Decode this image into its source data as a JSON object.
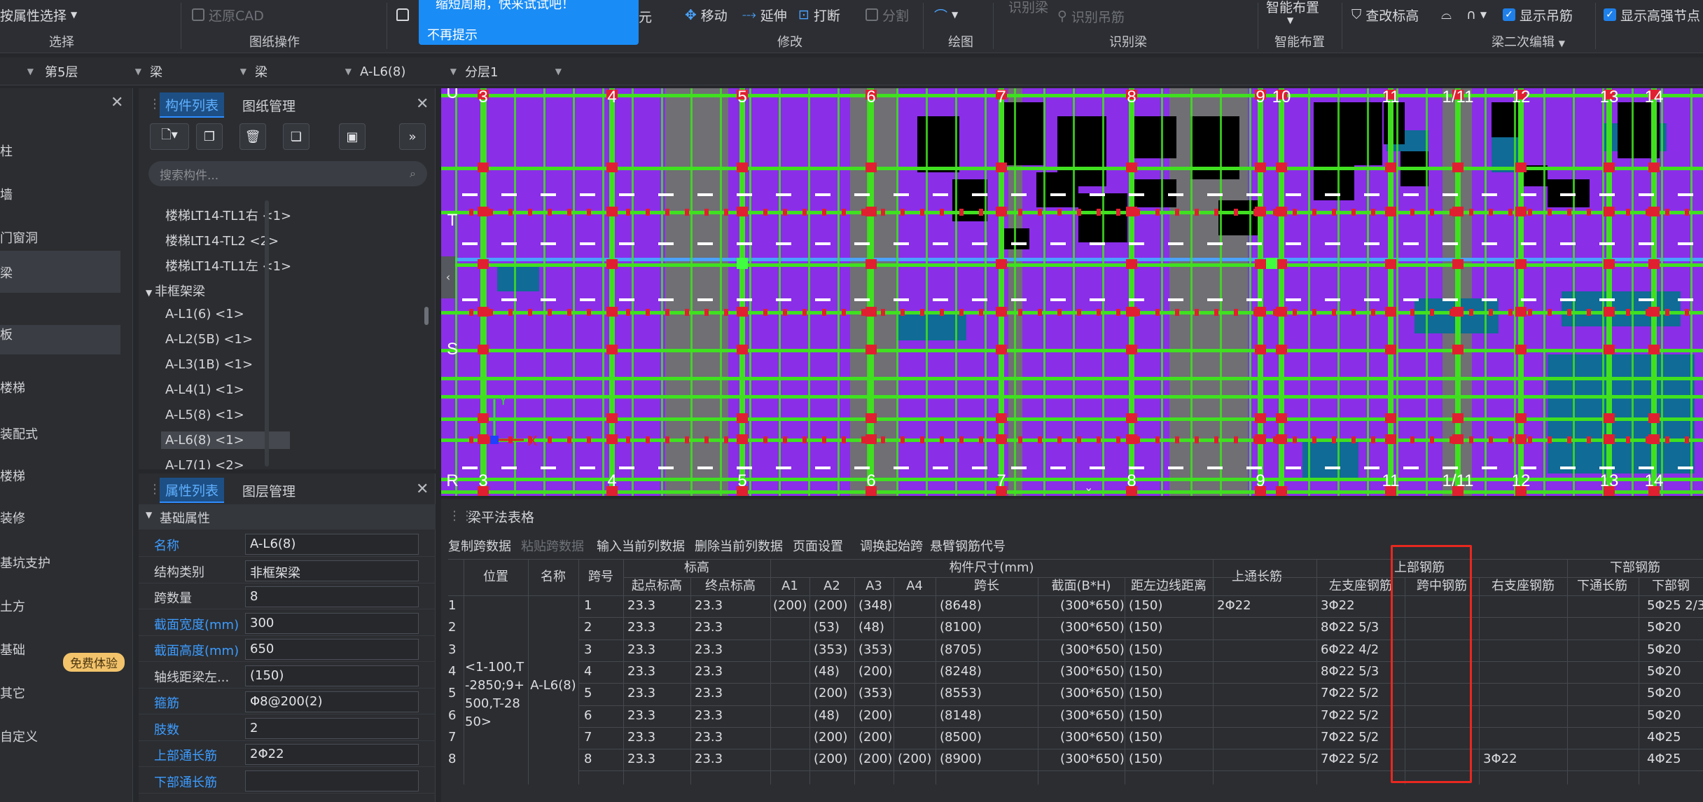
{
  "ribbon": {
    "select_by_attr": "按属性选择",
    "restore_cad": "还原CAD",
    "group_select": "选择",
    "group_drawing_ops": "图纸操作",
    "yuan": "元",
    "move": "移动",
    "extend": "延伸",
    "break": "打断",
    "split": "分割",
    "group_modify": "修改",
    "group_draw": "绘图",
    "identify_beam_label": "识别梁",
    "identify_hanger": "识别吊筋",
    "group_identify_beam": "识别梁",
    "smart_layout": "智能布置",
    "group_smart_layout": "智能布置",
    "check_elevation": "查改标高",
    "show_hanger": "显示吊筋",
    "show_strong_node": "显示高强节点",
    "group_beam_edit": "梁二次编辑"
  },
  "popup": {
    "message": "缩短周期，快来试试吧！",
    "dismiss": "不再提示"
  },
  "filter": {
    "floor": "第5层",
    "type1": "梁",
    "type2": "梁",
    "component": "A-L6(8)",
    "layer": "分层1"
  },
  "leftnav": {
    "items": [
      "柱",
      "墙",
      "门窗洞",
      "梁",
      "板",
      "楼梯",
      "装配式",
      "楼梯",
      "装修",
      "基坑支护",
      "土方",
      "基础",
      "其它",
      "自定义"
    ],
    "badge": "免费体验"
  },
  "comp_panel": {
    "tab_list": "构件列表",
    "tab_drawing": "图纸管理",
    "search_placeholder": "搜索构件...",
    "items": [
      "楼梯LT14-TL1右 <1>",
      "楼梯LT14-TL2 <2>",
      "楼梯LT14-TL1左 <1>"
    ],
    "group": "非框架梁",
    "beams": [
      "A-L1(6) <1>",
      "A-L2(5B) <1>",
      "A-L3(1B) <1>",
      "A-L4(1) <1>",
      "A-L5(8) <1>",
      "A-L6(8) <1>",
      "A-L7(1) <2>"
    ]
  },
  "prop_panel": {
    "tab_props": "属性列表",
    "tab_layers": "图层管理",
    "section": "基础属性",
    "rows": [
      {
        "name": "名称",
        "value": "A-L6(8)",
        "blue": true
      },
      {
        "name": "结构类别",
        "value": "非框架梁",
        "blue": false
      },
      {
        "name": "跨数量",
        "value": "8",
        "blue": false
      },
      {
        "name": "截面宽度(mm)",
        "value": "300",
        "blue": true
      },
      {
        "name": "截面高度(mm)",
        "value": "650",
        "blue": true
      },
      {
        "name": "轴线距梁左...",
        "value": "(150)",
        "blue": false
      },
      {
        "name": "箍筋",
        "value": "Φ8@200(2)",
        "blue": true
      },
      {
        "name": "肢数",
        "value": "2",
        "blue": true
      },
      {
        "name": "上部通长筋",
        "value": "2Φ22",
        "blue": true
      },
      {
        "name": "下部通长筋",
        "value": "",
        "blue": true
      }
    ]
  },
  "canvas": {
    "top_axes": [
      "3",
      "4",
      "5",
      "6",
      "7",
      "8",
      "9",
      "10",
      "11",
      "1/11",
      "12",
      "13",
      "14"
    ],
    "bottom_axes": [
      "3",
      "4",
      "5",
      "6",
      "7",
      "8",
      "9",
      "11",
      "1/11",
      "12",
      "13",
      "14"
    ],
    "row_labels": [
      "U",
      "T",
      "S",
      "R"
    ],
    "axis_x": "X",
    "axis_y": "Y"
  },
  "table_panel": {
    "title": "梁平法表格",
    "tools": [
      "复制跨数据",
      "粘贴跨数据",
      "输入当前列数据",
      "删除当前列数据",
      "页面设置",
      "调换起始跨",
      "悬臂钢筋代号"
    ],
    "headers": {
      "position": "位置",
      "name": "名称",
      "span": "跨号",
      "elevation": "标高",
      "start_elev": "起点标高",
      "end_elev": "终点标高",
      "size": "构件尺寸(mm)",
      "a1": "A1",
      "a2": "A2",
      "a3": "A3",
      "a4": "A4",
      "span_len": "跨长",
      "section": "截面(B*H)",
      "offset": "距左边线距离",
      "top_through": "上通长筋",
      "top_rebar": "上部钢筋",
      "left_seat": "左支座钢筋",
      "mid_span": "跨中钢筋",
      "right_seat": "右支座钢筋",
      "bottom_rebar": "下部钢筋",
      "bottom_through": "下通长筋",
      "bottom_more": "下部钢"
    },
    "merged_position": "<1-100,T-2850;9+500,T-2850>",
    "merged_name": "A-L6(8)",
    "rows": [
      {
        "idx": "1",
        "span": "1",
        "start": "23.3",
        "end": "23.3",
        "a1": "(200)",
        "a2": "(200)",
        "a3": "(348)",
        "a4": "",
        "len": "(8648)",
        "sec": "(300*650)",
        "off": "(150)",
        "top": "2Φ22",
        "left": "3Φ22",
        "mid": "",
        "right": "",
        "bthru": "",
        "bot": "5Φ25 2/3"
      },
      {
        "idx": "2",
        "span": "2",
        "start": "23.3",
        "end": "23.3",
        "a1": "",
        "a2": "(53)",
        "a3": "(48)",
        "a4": "",
        "len": "(8100)",
        "sec": "(300*650)",
        "off": "(150)",
        "top": "",
        "left": "8Φ22 5/3",
        "mid": "",
        "right": "",
        "bthru": "",
        "bot": "5Φ20"
      },
      {
        "idx": "3",
        "span": "3",
        "start": "23.3",
        "end": "23.3",
        "a1": "",
        "a2": "(353)",
        "a3": "(353)",
        "a4": "",
        "len": "(8705)",
        "sec": "(300*650)",
        "off": "(150)",
        "top": "",
        "left": "6Φ22 4/2",
        "mid": "",
        "right": "",
        "bthru": "",
        "bot": "5Φ20"
      },
      {
        "idx": "4",
        "span": "4",
        "start": "23.3",
        "end": "23.3",
        "a1": "",
        "a2": "(48)",
        "a3": "(200)",
        "a4": "",
        "len": "(8248)",
        "sec": "(300*650)",
        "off": "(150)",
        "top": "",
        "left": "8Φ22 5/3",
        "mid": "",
        "right": "",
        "bthru": "",
        "bot": "5Φ20"
      },
      {
        "idx": "5",
        "span": "5",
        "start": "23.3",
        "end": "23.3",
        "a1": "",
        "a2": "(200)",
        "a3": "(353)",
        "a4": "",
        "len": "(8553)",
        "sec": "(300*650)",
        "off": "(150)",
        "top": "",
        "left": "7Φ22 5/2",
        "mid": "",
        "right": "",
        "bthru": "",
        "bot": "5Φ20"
      },
      {
        "idx": "6",
        "span": "6",
        "start": "23.3",
        "end": "23.3",
        "a1": "",
        "a2": "(48)",
        "a3": "(200)",
        "a4": "",
        "len": "(8148)",
        "sec": "(300*650)",
        "off": "(150)",
        "top": "",
        "left": "7Φ22 5/2",
        "mid": "",
        "right": "",
        "bthru": "",
        "bot": "5Φ20"
      },
      {
        "idx": "7",
        "span": "7",
        "start": "23.3",
        "end": "23.3",
        "a1": "",
        "a2": "(200)",
        "a3": "(200)",
        "a4": "",
        "len": "(8500)",
        "sec": "(300*650)",
        "off": "(150)",
        "top": "",
        "left": "7Φ22 5/2",
        "mid": "",
        "right": "",
        "bthru": "",
        "bot": "4Φ25"
      },
      {
        "idx": "8",
        "span": "8",
        "start": "23.3",
        "end": "23.3",
        "a1": "",
        "a2": "(200)",
        "a3": "(200)",
        "a4": "(200)",
        "len": "(8900)",
        "sec": "(300*650)",
        "off": "(150)",
        "top": "",
        "left": "7Φ22 5/2",
        "mid": "",
        "right": "3Φ22",
        "bthru": "",
        "bot": "4Φ25"
      }
    ]
  },
  "colors": {
    "accent": "#1f80ea",
    "highlight_box": "#e8281f",
    "canvas_purple": "#8a2ee8",
    "canvas_green": "#40e020"
  }
}
